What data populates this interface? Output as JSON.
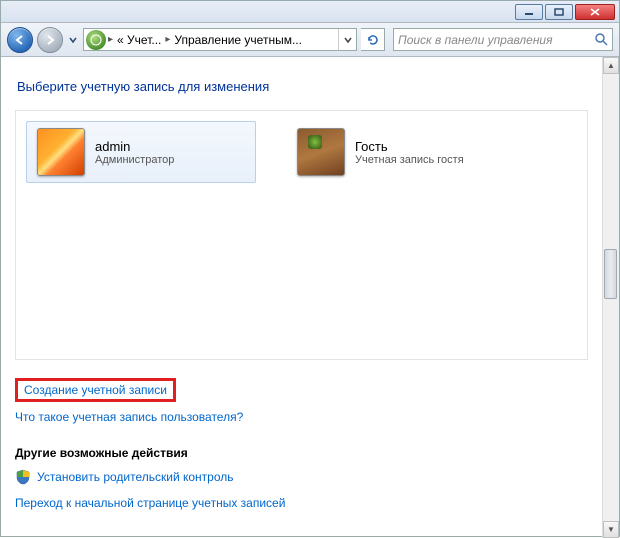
{
  "breadcrumb": {
    "seg1": "« Учет...",
    "seg2": "Управление учетным..."
  },
  "search": {
    "placeholder": "Поиск в панели управления"
  },
  "instruction": "Выберите учетную запись для изменения",
  "accounts": [
    {
      "name": "admin",
      "role": "Администратор"
    },
    {
      "name": "Гость",
      "role": "Учетная запись гостя"
    }
  ],
  "links": {
    "create": "Создание учетной записи",
    "whatis": "Что такое учетная запись пользователя?"
  },
  "other": {
    "title": "Другие возможные действия",
    "parental": "Установить родительский контроль",
    "gohome": "Переход к начальной странице учетных записей"
  }
}
